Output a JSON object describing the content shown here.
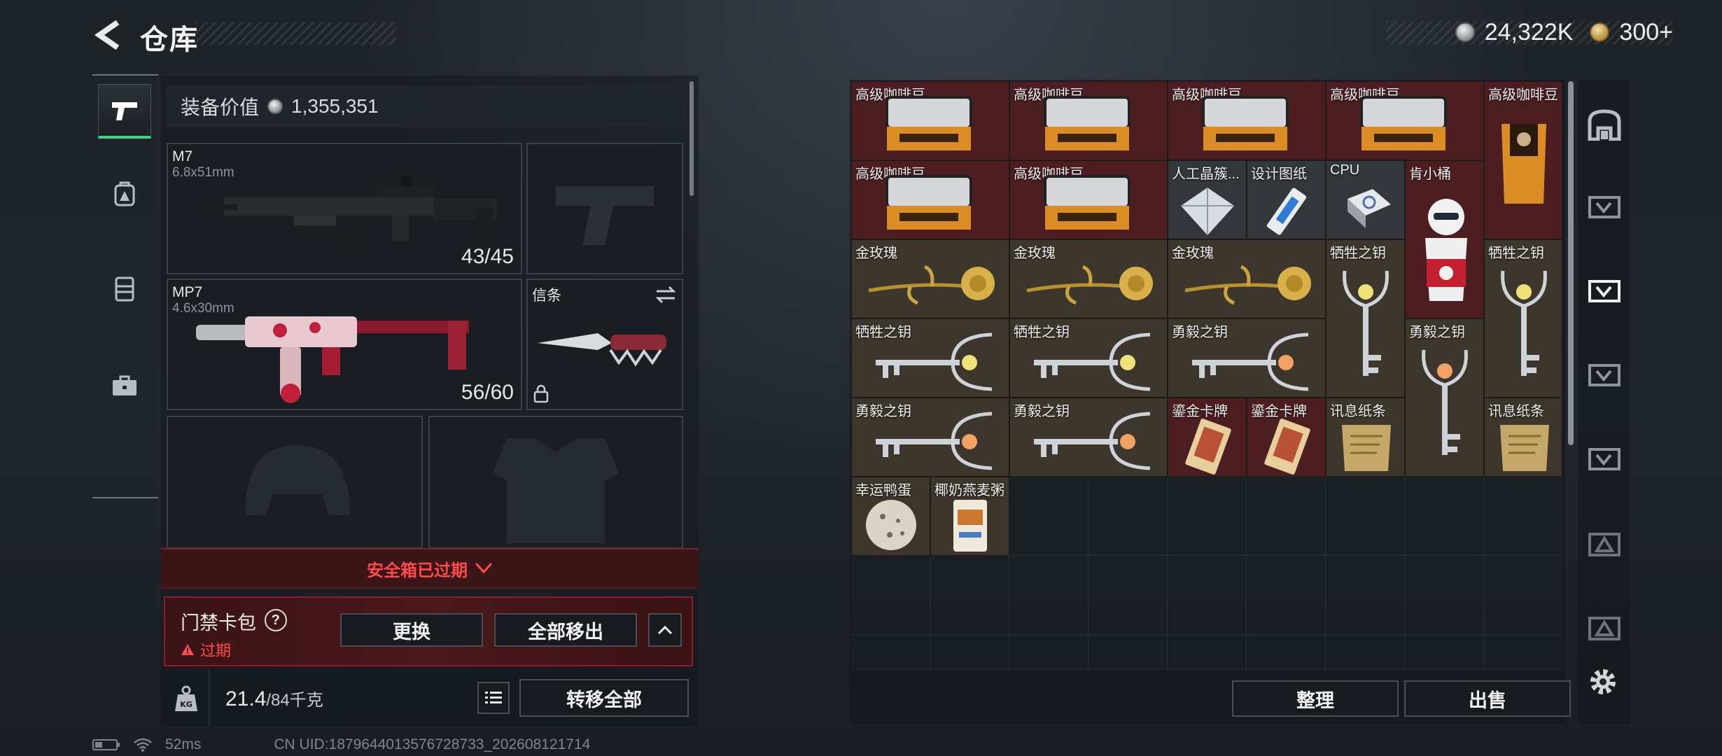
{
  "header": {
    "title": "仓库",
    "currency": {
      "silver": "24,322K",
      "gold": "300+"
    }
  },
  "left_rail": {
    "items": [
      {
        "name": "weapon"
      },
      {
        "name": "backpack"
      },
      {
        "name": "vest"
      },
      {
        "name": "case"
      }
    ]
  },
  "equipment": {
    "value_label": "装备价值",
    "value": "1,355,351",
    "primary": {
      "name": "M7",
      "caliber": "6.8x51mm",
      "ammo": "43/45"
    },
    "secondary": {
      "name": "MP7",
      "caliber": "4.6x30mm",
      "ammo": "56/60"
    },
    "melee": {
      "name": "信条"
    }
  },
  "safe_case": {
    "label": "安全箱已过期"
  },
  "card_pack": {
    "title": "门禁卡包",
    "help": "?",
    "status": "过期",
    "replace_label": "更换",
    "remove_all_label": "全部移出"
  },
  "weight": {
    "current": "21.4",
    "max": "/84千克"
  },
  "transfer_all_label": "转移全部",
  "grid": {
    "items": [
      {
        "label": "高级咖啡豆"
      },
      {
        "label": "高级咖啡豆"
      },
      {
        "label": "高级咖啡豆"
      },
      {
        "label": "高级咖啡豆"
      },
      {
        "label": "高级咖啡豆"
      },
      {
        "label": "高级咖啡豆"
      },
      {
        "label": "高级咖啡豆"
      },
      {
        "label": "人工晶簇..."
      },
      {
        "label": "设计图纸"
      },
      {
        "label": "CPU"
      },
      {
        "label": "肯小桶"
      },
      {
        "label": "金玫瑰"
      },
      {
        "label": "金玫瑰"
      },
      {
        "label": "金玫瑰"
      },
      {
        "label": "牺牲之钥"
      },
      {
        "label": "牺牲之钥"
      },
      {
        "label": "牺牲之钥"
      },
      {
        "label": "牺牲之钥"
      },
      {
        "label": "勇毅之钥"
      },
      {
        "label": "勇毅之钥"
      },
      {
        "label": "勇毅之钥"
      },
      {
        "label": "勇毅之钥"
      },
      {
        "label": "鎏金卡牌"
      },
      {
        "label": "鎏金卡牌"
      },
      {
        "label": "讯息纸条"
      },
      {
        "label": "讯息纸条"
      },
      {
        "label": "幸运鸭蛋"
      },
      {
        "label": "椰奶燕麦粥"
      }
    ]
  },
  "actions": {
    "sort_label": "整理",
    "sell_label": "出售"
  },
  "footer": {
    "ping": "52ms",
    "uid": "CN UID:1879644013576728733_202608121714"
  },
  "colors": {
    "accent_green": "#3fd08a",
    "expired_red": "#ff4a4a"
  }
}
